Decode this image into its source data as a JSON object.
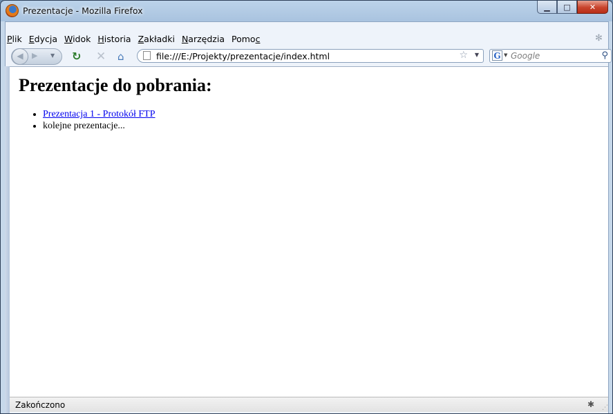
{
  "window": {
    "title": "Prezentacje - Mozilla Firefox",
    "caption_buttons": {
      "minimize": "▁",
      "maximize": "□",
      "close": "✕"
    }
  },
  "menubar": {
    "items": [
      {
        "label": "Plik",
        "accel": "P",
        "rest": "lik"
      },
      {
        "label": "Edycja",
        "accel": "E",
        "rest": "dycja"
      },
      {
        "label": "Widok",
        "accel": "W",
        "rest": "idok"
      },
      {
        "label": "Historia",
        "accel": "H",
        "rest": "istoria"
      },
      {
        "label": "Zakładki",
        "accel": "Z",
        "rest": "akładki"
      },
      {
        "label": "Narzędzia",
        "accel": "N",
        "rest": "arzędzia"
      },
      {
        "label": "Pomoc",
        "pre": "Pomo",
        "accel": "c"
      }
    ]
  },
  "navbar": {
    "url": "file:///E:/Projekty/prezentacje/index.html",
    "search_placeholder": "Google",
    "icons": {
      "back": "back-icon",
      "forward": "forward-icon",
      "reload": "reload-icon",
      "stop": "stop-icon",
      "home": "home-icon",
      "bookmark": "star-icon",
      "search": "magnifier-icon",
      "engine": "google-icon"
    }
  },
  "page": {
    "heading": "Prezentacje do pobrania:",
    "items": [
      {
        "text": "Prezentacja 1 - Protokół FTP",
        "is_link": true
      },
      {
        "text": "kolejne prezentacje...",
        "is_link": false
      }
    ]
  },
  "statusbar": {
    "text": "Zakończono"
  }
}
